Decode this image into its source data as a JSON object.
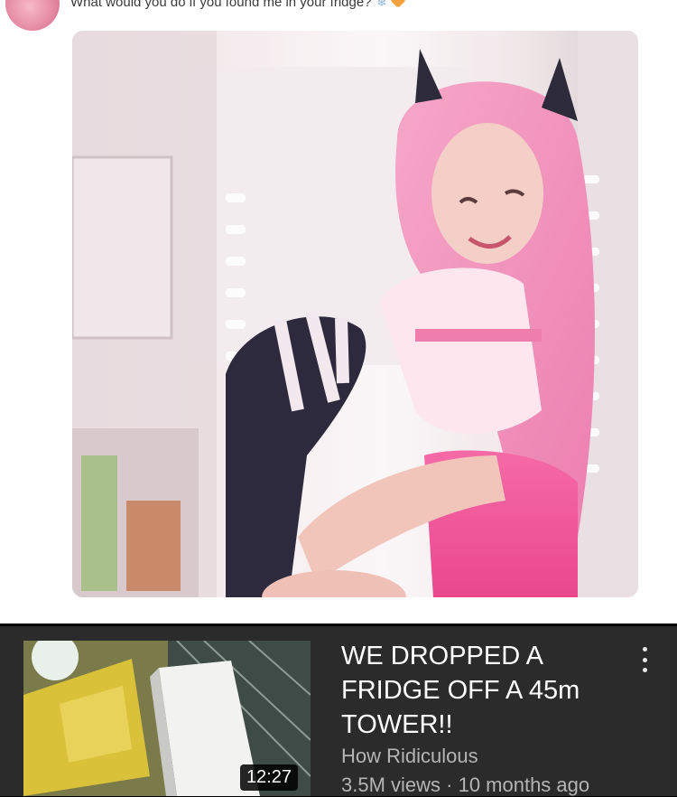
{
  "post": {
    "caption": "What would you do if you found me in your fridge?",
    "emojis": [
      "snowflake-icon",
      "orange-heart-icon"
    ]
  },
  "video": {
    "title": "WE DROPPED A FRIDGE OFF A 45m TOWER!!",
    "channel": "How Ridiculous",
    "meta": "3.5M views · 10 months ago",
    "duration": "12:27"
  },
  "colors": {
    "post_background": "#ffffff",
    "video_background": "#2b2b2b",
    "title_text": "#ffffff",
    "secondary_text": "#b5b5b5"
  }
}
